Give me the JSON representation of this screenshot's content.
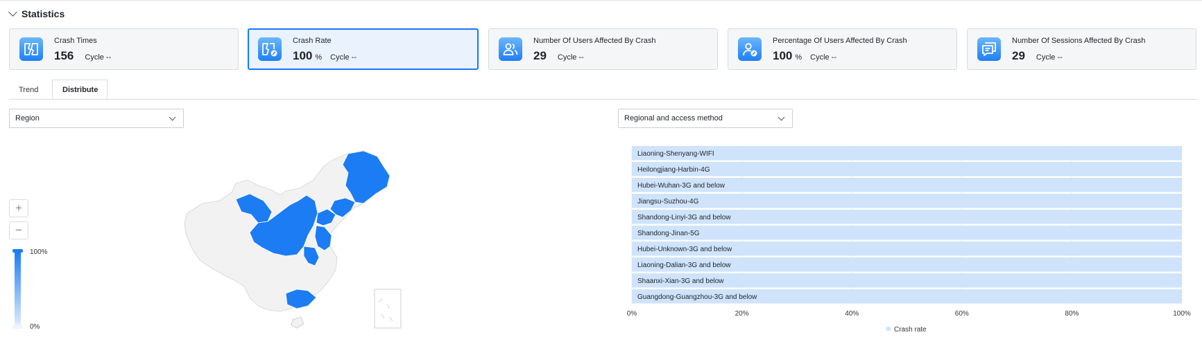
{
  "section": {
    "title": "Statistics"
  },
  "cards": [
    {
      "label": "Crash Times",
      "value": "156",
      "unit": "",
      "cycle": "Cycle --"
    },
    {
      "label": "Crash Rate",
      "value": "100",
      "unit": "%",
      "cycle": "Cycle --"
    },
    {
      "label": "Number Of Users Affected By Crash",
      "value": "29",
      "unit": "",
      "cycle": "Cycle --"
    },
    {
      "label": "Percentage Of Users Affected By Crash",
      "value": "100",
      "unit": "%",
      "cycle": "Cycle --"
    },
    {
      "label": "Number Of Sessions Affected By Crash",
      "value": "29",
      "unit": "",
      "cycle": "Cycle --"
    }
  ],
  "tabs": [
    {
      "label": "Trend"
    },
    {
      "label": "Distribute"
    }
  ],
  "selects": {
    "left": "Region",
    "right": "Regional and access method"
  },
  "map_controls": {
    "zoom_in": "+",
    "zoom_out": "−"
  },
  "map_legend": {
    "max": "100%",
    "min": "0%"
  },
  "colors": {
    "accent": "#1677ff",
    "map_fill": "#1b7cf3",
    "bar_fill": "#cfe3fb"
  },
  "chart_data": {
    "type": "bar",
    "orientation": "horizontal",
    "categories": [
      "Liaoning-Shenyang-WIFI",
      "Heilongjiang-Harbin-4G",
      "Hubei-Wuhan-3G and below",
      "Jiangsu-Suzhou-4G",
      "Shandong-Linyi-3G and below",
      "Shandong-Jinan-5G",
      "Hubei-Unknown-3G and below",
      "Liaoning-Dalian-3G and below",
      "Shaanxi-Xian-3G and below",
      "Guangdong-Guangzhou-3G and below"
    ],
    "series": [
      {
        "name": "Crash rate",
        "values": [
          100,
          100,
          100,
          100,
          100,
          100,
          100,
          100,
          100,
          100
        ]
      }
    ],
    "xticks": [
      "0%",
      "20%",
      "40%",
      "60%",
      "80%",
      "100%"
    ],
    "xlim": [
      0,
      100
    ],
    "grid": true,
    "legend": "bottom-center"
  }
}
